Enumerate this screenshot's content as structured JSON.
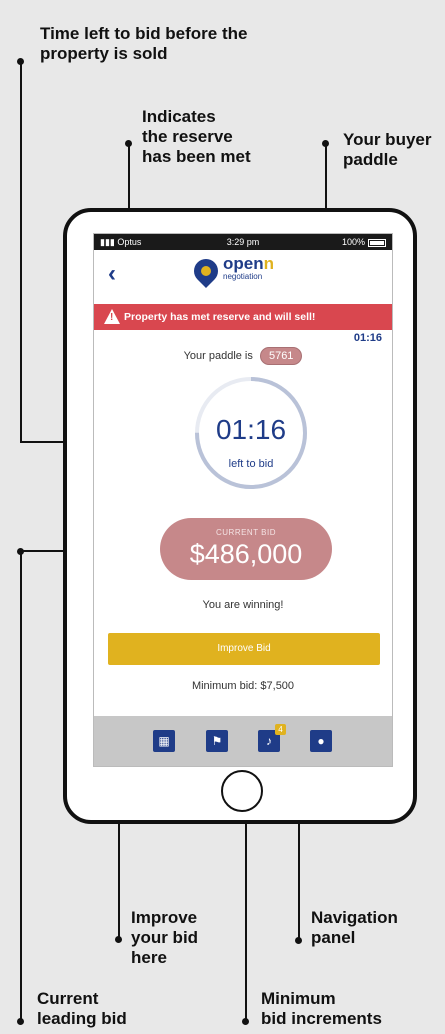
{
  "callouts": {
    "time_left_1": "Time left to bid before the",
    "time_left_2": "property is sold",
    "reserve_1": "Indicates",
    "reserve_2": "the reserve",
    "reserve_3": "has been met",
    "paddle_1": "Your buyer",
    "paddle_2": "paddle",
    "improve_1": "Improve",
    "improve_2": "your bid",
    "improve_3": "here",
    "navigation_1": "Navigation",
    "navigation_2": "panel",
    "current_1": "Current",
    "current_2": "leading bid",
    "minimum_1": "Minimum",
    "minimum_2": "bid increments"
  },
  "statusbar": {
    "carrier": "Optus",
    "time": "3:29 pm",
    "battery": "100%"
  },
  "app": {
    "logo_word_a": "open",
    "logo_word_b": "n",
    "logo_sub": "negotiation",
    "banner": "Property has met reserve and will sell!",
    "banner_time": "01:16",
    "paddle_label": "Your paddle is",
    "paddle_number": "5761",
    "timer_value": "01:16",
    "timer_label": "left to bid",
    "timer_progress": 0.75,
    "bid_label": "CURRENT BID",
    "bid_value": "$486,000",
    "status": "You are winning!",
    "improve_button": "Improve Bid",
    "minimum_bid": "Minimum bid: $7,500",
    "notification_count": "4"
  },
  "colors": {
    "brand_blue": "#1f3c88",
    "brand_gold": "#e0b21f",
    "banner_red": "#d9474f",
    "bid_pill": "#c6888a"
  },
  "icons": [
    "back-chevron-icon",
    "warning-icon",
    "grid-icon",
    "flag-icon",
    "bell-icon",
    "user-icon"
  ]
}
